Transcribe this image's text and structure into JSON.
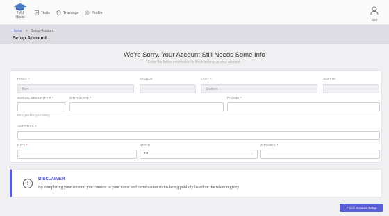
{
  "brand": {
    "name": "TMU Quest",
    "line1": "TMU",
    "line2": "Quest"
  },
  "nav": [
    {
      "label": "Tests",
      "icon": "document-icon"
    },
    {
      "label": "Trainings",
      "icon": "training-icon"
    },
    {
      "label": "Profile",
      "icon": "gear-icon"
    }
  ],
  "profile": {
    "name": "Bert",
    "icon": "user-avatar-icon"
  },
  "breadcrumb": {
    "home": "Home",
    "separator": ">",
    "current": "Setup Account"
  },
  "page_title": "Setup Account",
  "heading": "We're Sorry, Your Account Still Needs Some Info",
  "subheading": "Enter the below information to finish setting up your account.",
  "form": {
    "first": {
      "label": "FIRST",
      "required": "*",
      "value": "Bert"
    },
    "middle": {
      "label": "MIDDLE",
      "value": ""
    },
    "last": {
      "label": "LAST",
      "required": "*",
      "value": "Student"
    },
    "suffix": {
      "label": "SUFFIX",
      "value": ""
    },
    "ssn": {
      "label": "SOCIAL SECURITY #",
      "required": "*",
      "value": "",
      "hint": "Encrypted for your safety"
    },
    "birthdate": {
      "label": "BIRTHDATE",
      "required": "*",
      "value": ""
    },
    "phone": {
      "label": "PHONE",
      "required": "*",
      "value": ""
    },
    "address": {
      "label": "ADDRESS",
      "required": "*",
      "value": ""
    },
    "city": {
      "label": "CITY",
      "required": "*",
      "value": ""
    },
    "state": {
      "label": "STATE",
      "value": "ID",
      "options": [
        "ID"
      ]
    },
    "zipcode": {
      "label": "ZIPCODE",
      "required": "*",
      "value": ""
    }
  },
  "disclaimer": {
    "title": "DISCLAIMER",
    "icon": "exclamation-circle-icon",
    "text": "By completing your account you consent to your name and certification status being publicly listed on the Idaho registry"
  },
  "finish_button": "Finish Account Setup",
  "colors": {
    "accent": "#5b5fd6",
    "required": "#d94545",
    "page_bg": "#f0f0f3"
  }
}
